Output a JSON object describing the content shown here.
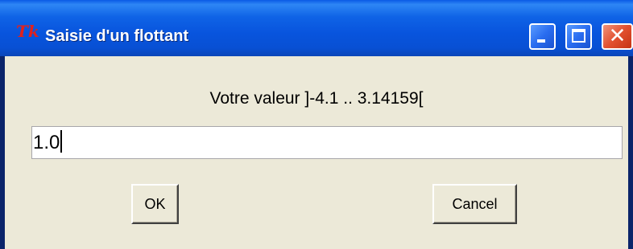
{
  "window": {
    "title": "Saisie d'un flottant",
    "app_icon_text": "Tk"
  },
  "titlebar_buttons": {
    "minimize": "minimize-icon",
    "maximize": "maximize-icon",
    "close": "close-icon",
    "close_glyph": "✕"
  },
  "dialog": {
    "prompt": "Votre valeur ]-4.1 .. 3.14159[",
    "entry_value": "1.0",
    "ok_label": "OK",
    "cancel_label": "Cancel"
  },
  "colors": {
    "titlebar": "#0854dd",
    "client_background": "#ece9d8",
    "close_button": "#e2502f",
    "tk_logo": "#e2211b"
  }
}
